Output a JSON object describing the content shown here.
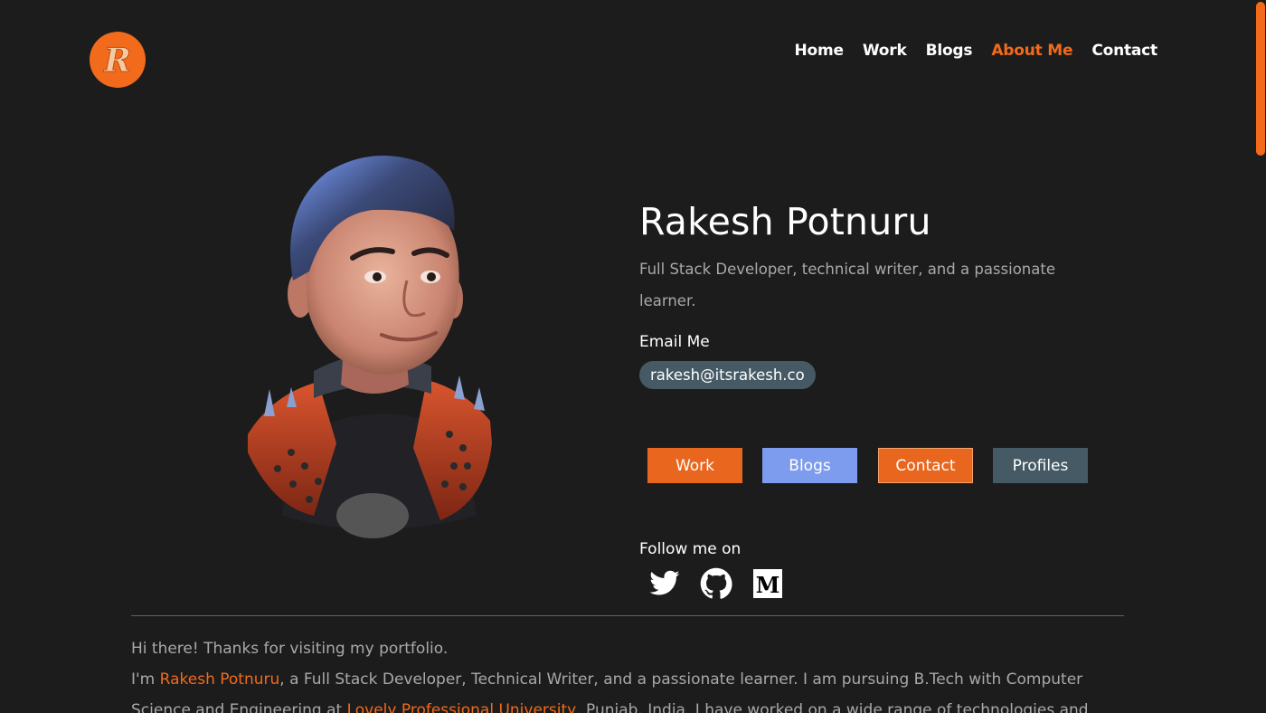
{
  "header": {
    "logo_letter": "R",
    "nav": [
      "Home",
      "Work",
      "Blogs",
      "About Me",
      "Contact"
    ],
    "active_nav": "About Me"
  },
  "profile": {
    "name": "Rakesh Potnuru",
    "tagline": "Full Stack Developer, technical writer, and a passionate learner.",
    "email_label": "Email Me",
    "email": "rakesh@itsrakesh.co"
  },
  "buttons": {
    "work": "Work",
    "blogs": "Blogs",
    "contact": "Contact",
    "profiles": "Profiles"
  },
  "follow": {
    "label": "Follow me on",
    "icons": [
      "twitter-icon",
      "github-icon",
      "medium-icon"
    ]
  },
  "about": {
    "line1": "Hi there! Thanks for visiting my portfolio.",
    "line2_prefix": "I'm ",
    "line2_name": "Rakesh Potnuru",
    "line2_rest": ", a Full Stack Developer, Technical Writer, and a passionate learner. I am pursuing B.Tech with Computer",
    "line3_prefix": "Science and Engineering at ",
    "line3_university": "Lovely Professional University",
    "line3_rest": ", Punjab, India. I have worked on a wide range of technologies and"
  },
  "colors": {
    "background": "#1c1c1c",
    "accent": "#f26a1b",
    "blogs_button": "#7e9cee",
    "profiles_button": "#455a64",
    "muted_text": "#a9a9a9"
  }
}
